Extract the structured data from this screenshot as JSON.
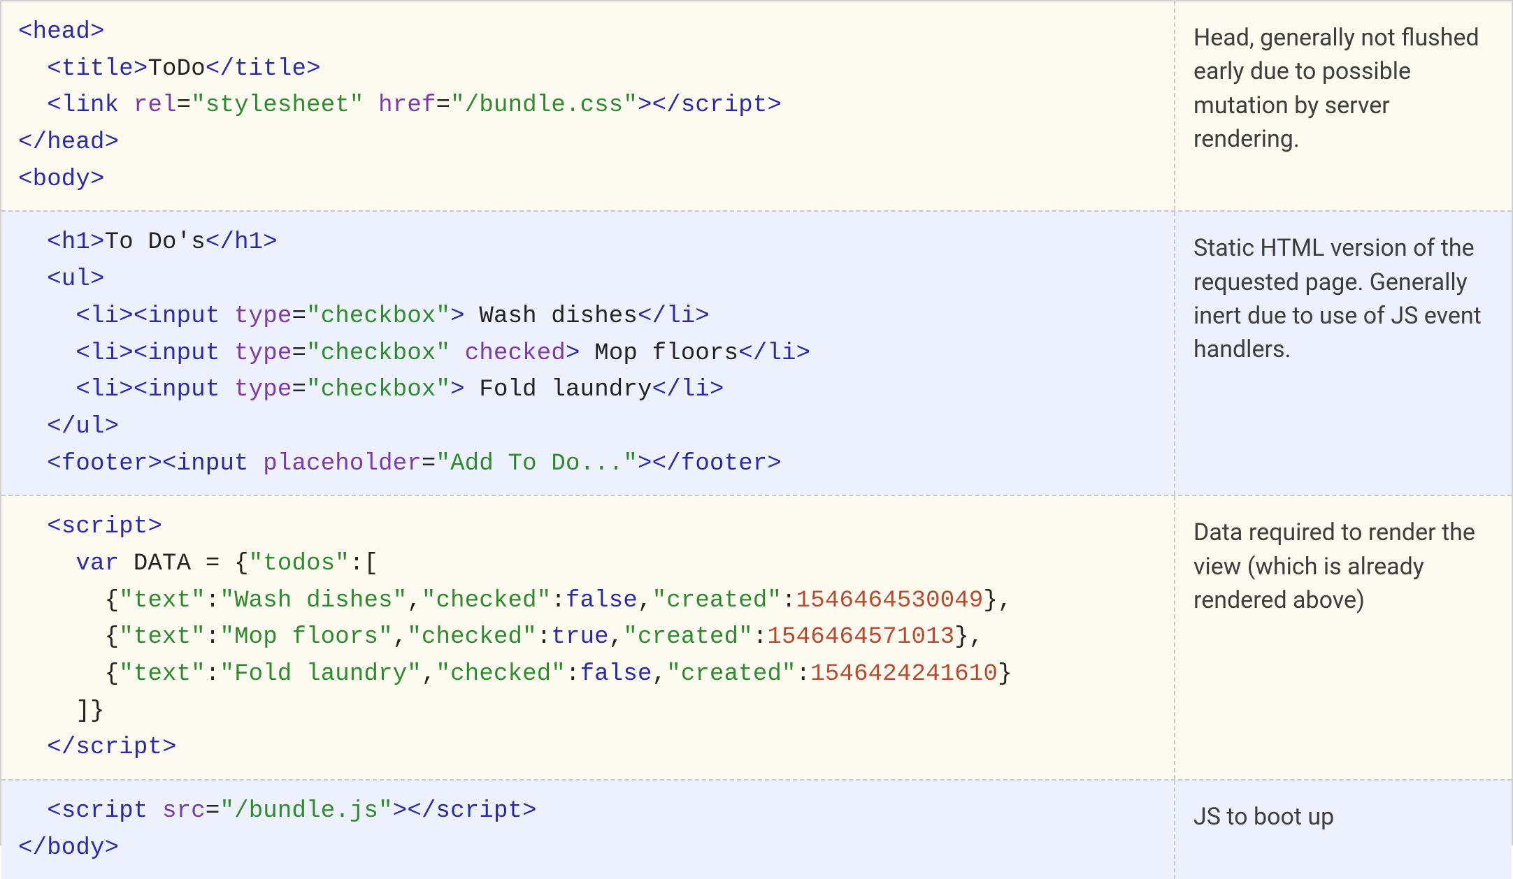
{
  "rows": [
    {
      "bg": "cream",
      "annotation": "Head, generally not flushed early due to possible mutation by server rendering.",
      "code": [
        [
          {
            "c": "tag",
            "t": "<head>"
          }
        ],
        [
          {
            "c": "pun",
            "t": "  "
          },
          {
            "c": "tag",
            "t": "<title>"
          },
          {
            "c": "txt",
            "t": "ToDo"
          },
          {
            "c": "tag",
            "t": "</title>"
          }
        ],
        [
          {
            "c": "pun",
            "t": "  "
          },
          {
            "c": "tag",
            "t": "<link"
          },
          {
            "c": "txt",
            "t": " "
          },
          {
            "c": "attr",
            "t": "rel"
          },
          {
            "c": "pun",
            "t": "="
          },
          {
            "c": "val",
            "t": "\"stylesheet\""
          },
          {
            "c": "txt",
            "t": " "
          },
          {
            "c": "attr",
            "t": "href"
          },
          {
            "c": "pun",
            "t": "="
          },
          {
            "c": "val",
            "t": "\"/bundle.css\""
          },
          {
            "c": "tag",
            "t": "></script​>"
          }
        ],
        [
          {
            "c": "tag",
            "t": "</head>"
          }
        ],
        [
          {
            "c": "tag",
            "t": "<body>"
          }
        ]
      ]
    },
    {
      "bg": "blue",
      "annotation": "Static HTML version of the requested page. Generally inert due to use of JS event handlers.",
      "code": [
        [
          {
            "c": "pun",
            "t": "  "
          },
          {
            "c": "tag",
            "t": "<h1>"
          },
          {
            "c": "txt",
            "t": "To Do's"
          },
          {
            "c": "tag",
            "t": "</h1>"
          }
        ],
        [
          {
            "c": "pun",
            "t": "  "
          },
          {
            "c": "tag",
            "t": "<ul>"
          }
        ],
        [
          {
            "c": "pun",
            "t": "    "
          },
          {
            "c": "tag",
            "t": "<li><input"
          },
          {
            "c": "txt",
            "t": " "
          },
          {
            "c": "attr",
            "t": "type"
          },
          {
            "c": "pun",
            "t": "="
          },
          {
            "c": "val",
            "t": "\"checkbox\""
          },
          {
            "c": "tag",
            "t": ">"
          },
          {
            "c": "txt",
            "t": " Wash dishes"
          },
          {
            "c": "tag",
            "t": "</li>"
          }
        ],
        [
          {
            "c": "pun",
            "t": "    "
          },
          {
            "c": "tag",
            "t": "<li><input"
          },
          {
            "c": "txt",
            "t": " "
          },
          {
            "c": "attr",
            "t": "type"
          },
          {
            "c": "pun",
            "t": "="
          },
          {
            "c": "val",
            "t": "\"checkbox\""
          },
          {
            "c": "txt",
            "t": " "
          },
          {
            "c": "attr",
            "t": "checked"
          },
          {
            "c": "tag",
            "t": ">"
          },
          {
            "c": "txt",
            "t": " Mop floors"
          },
          {
            "c": "tag",
            "t": "</li>"
          }
        ],
        [
          {
            "c": "pun",
            "t": "    "
          },
          {
            "c": "tag",
            "t": "<li><input"
          },
          {
            "c": "txt",
            "t": " "
          },
          {
            "c": "attr",
            "t": "type"
          },
          {
            "c": "pun",
            "t": "="
          },
          {
            "c": "val",
            "t": "\"checkbox\""
          },
          {
            "c": "tag",
            "t": ">"
          },
          {
            "c": "txt",
            "t": " Fold laundry"
          },
          {
            "c": "tag",
            "t": "</li>"
          }
        ],
        [
          {
            "c": "pun",
            "t": "  "
          },
          {
            "c": "tag",
            "t": "</ul>"
          }
        ],
        [
          {
            "c": "pun",
            "t": "  "
          },
          {
            "c": "tag",
            "t": "<footer><input"
          },
          {
            "c": "txt",
            "t": " "
          },
          {
            "c": "attr",
            "t": "placeholder"
          },
          {
            "c": "pun",
            "t": "="
          },
          {
            "c": "val",
            "t": "\"Add To Do...\""
          },
          {
            "c": "tag",
            "t": "></footer>"
          }
        ]
      ]
    },
    {
      "bg": "cream",
      "annotation": "Data required to render the view (which is already rendered above)",
      "code": [
        [
          {
            "c": "pun",
            "t": "  "
          },
          {
            "c": "tag",
            "t": "<script>"
          }
        ],
        [
          {
            "c": "pun",
            "t": "    "
          },
          {
            "c": "kw",
            "t": "var"
          },
          {
            "c": "txt",
            "t": " DATA "
          },
          {
            "c": "pun",
            "t": "= {"
          },
          {
            "c": "val",
            "t": "\"todos\""
          },
          {
            "c": "pun",
            "t": ":["
          }
        ],
        [
          {
            "c": "pun",
            "t": "      {"
          },
          {
            "c": "val",
            "t": "\"text\""
          },
          {
            "c": "pun",
            "t": ":"
          },
          {
            "c": "val",
            "t": "\"Wash dishes\""
          },
          {
            "c": "pun",
            "t": ","
          },
          {
            "c": "val",
            "t": "\"checked\""
          },
          {
            "c": "pun",
            "t": ":"
          },
          {
            "c": "bool",
            "t": "false"
          },
          {
            "c": "pun",
            "t": ","
          },
          {
            "c": "val",
            "t": "\"created\""
          },
          {
            "c": "pun",
            "t": ":"
          },
          {
            "c": "num",
            "t": "1546464530049"
          },
          {
            "c": "pun",
            "t": "},"
          }
        ],
        [
          {
            "c": "pun",
            "t": "      {"
          },
          {
            "c": "val",
            "t": "\"text\""
          },
          {
            "c": "pun",
            "t": ":"
          },
          {
            "c": "val",
            "t": "\"Mop floors\""
          },
          {
            "c": "pun",
            "t": ","
          },
          {
            "c": "val",
            "t": "\"checked\""
          },
          {
            "c": "pun",
            "t": ":"
          },
          {
            "c": "bool",
            "t": "true"
          },
          {
            "c": "pun",
            "t": ","
          },
          {
            "c": "val",
            "t": "\"created\""
          },
          {
            "c": "pun",
            "t": ":"
          },
          {
            "c": "num",
            "t": "1546464571013"
          },
          {
            "c": "pun",
            "t": "},"
          }
        ],
        [
          {
            "c": "pun",
            "t": "      {"
          },
          {
            "c": "val",
            "t": "\"text\""
          },
          {
            "c": "pun",
            "t": ":"
          },
          {
            "c": "val",
            "t": "\"Fold laundry\""
          },
          {
            "c": "pun",
            "t": ","
          },
          {
            "c": "val",
            "t": "\"checked\""
          },
          {
            "c": "pun",
            "t": ":"
          },
          {
            "c": "bool",
            "t": "false"
          },
          {
            "c": "pun",
            "t": ","
          },
          {
            "c": "val",
            "t": "\"created\""
          },
          {
            "c": "pun",
            "t": ":"
          },
          {
            "c": "num",
            "t": "1546424241610"
          },
          {
            "c": "pun",
            "t": "}"
          }
        ],
        [
          {
            "c": "pun",
            "t": "    ]}"
          }
        ],
        [
          {
            "c": "pun",
            "t": "  "
          },
          {
            "c": "tag",
            "t": "</script​>"
          }
        ]
      ]
    },
    {
      "bg": "blue",
      "annotation": "JS to boot up",
      "code": [
        [
          {
            "c": "pun",
            "t": "  "
          },
          {
            "c": "tag",
            "t": "<script"
          },
          {
            "c": "txt",
            "t": " "
          },
          {
            "c": "attr",
            "t": "src"
          },
          {
            "c": "pun",
            "t": "="
          },
          {
            "c": "val",
            "t": "\"/bundle.js\""
          },
          {
            "c": "tag",
            "t": "></script​>"
          }
        ],
        [
          {
            "c": "tag",
            "t": "</body>"
          }
        ]
      ]
    }
  ]
}
